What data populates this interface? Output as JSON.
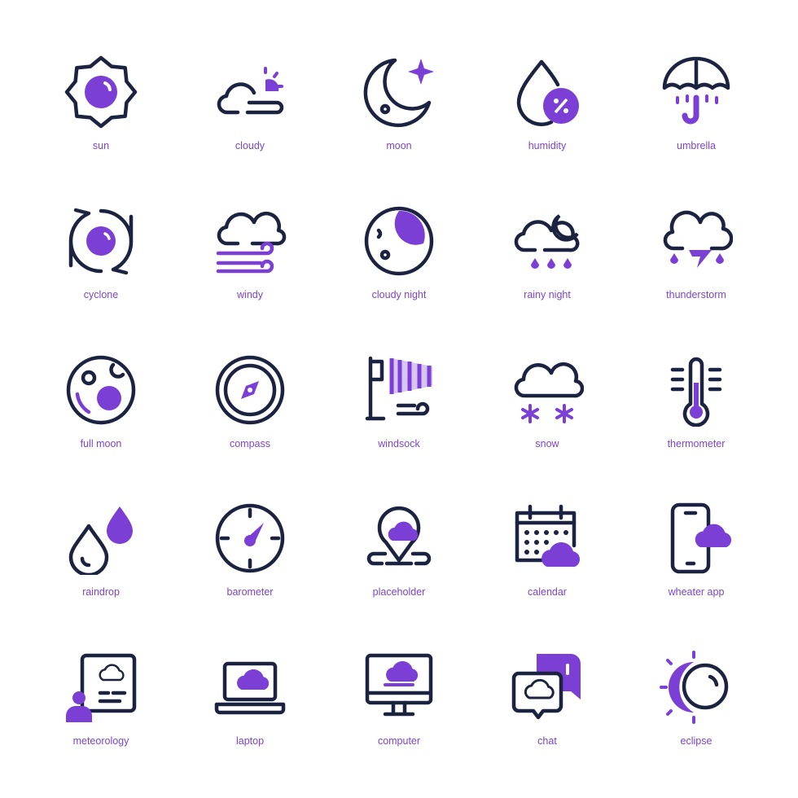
{
  "colors": {
    "outline": "#1b2340",
    "accent": "#7b3fd6",
    "label": "#7a45cf",
    "background": "#ffffff"
  },
  "icons": [
    {
      "icon": "sun-icon",
      "label": "sun"
    },
    {
      "icon": "cloudy-icon",
      "label": "cloudy"
    },
    {
      "icon": "moon-icon",
      "label": "moon"
    },
    {
      "icon": "humidity-icon",
      "label": "humidity"
    },
    {
      "icon": "umbrella-icon",
      "label": "umbrella"
    },
    {
      "icon": "cyclone-icon",
      "label": "cyclone"
    },
    {
      "icon": "windy-icon",
      "label": "windy"
    },
    {
      "icon": "cloudy-night-icon",
      "label": "cloudy night"
    },
    {
      "icon": "rainy-night-icon",
      "label": "rainy night"
    },
    {
      "icon": "thunderstorm-icon",
      "label": "thunderstorm"
    },
    {
      "icon": "full-moon-icon",
      "label": "full moon"
    },
    {
      "icon": "compass-icon",
      "label": "compass"
    },
    {
      "icon": "windsock-icon",
      "label": "windsock"
    },
    {
      "icon": "snow-icon",
      "label": "snow"
    },
    {
      "icon": "thermometer-icon",
      "label": "thermometer"
    },
    {
      "icon": "raindrop-icon",
      "label": "raindrop"
    },
    {
      "icon": "barometer-icon",
      "label": "barometer"
    },
    {
      "icon": "placeholder-icon",
      "label": "placeholder"
    },
    {
      "icon": "calendar-icon",
      "label": "calendar"
    },
    {
      "icon": "weather-app-icon",
      "label": "wheater app"
    },
    {
      "icon": "meteorology-icon",
      "label": "meteorology"
    },
    {
      "icon": "laptop-icon",
      "label": "laptop"
    },
    {
      "icon": "computer-icon",
      "label": "computer"
    },
    {
      "icon": "chat-icon",
      "label": "chat"
    },
    {
      "icon": "eclipse-icon",
      "label": "eclipse"
    }
  ]
}
